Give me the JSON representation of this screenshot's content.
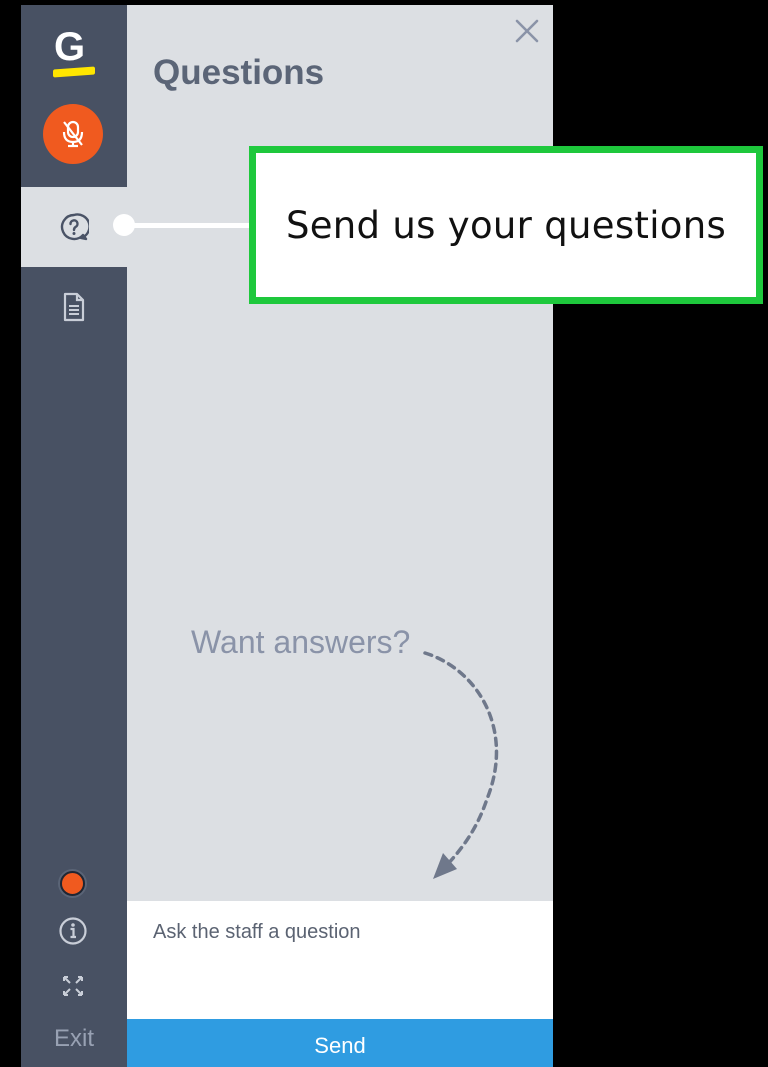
{
  "sidebar": {
    "logo_letter": "G",
    "icons": {
      "mic": "mic-off-icon",
      "questions": "question-bubble-icon",
      "handouts": "document-icon",
      "info": "info-icon",
      "fullscreen": "fullscreen-icon"
    },
    "exit_label": "Exit"
  },
  "panel": {
    "title": "Questions",
    "hint": "Want answers?",
    "input_placeholder": "Ask the staff a question",
    "send_label": "Send"
  },
  "tooltip": {
    "text": "Send us your questions"
  },
  "colors": {
    "sidebar_bg": "#485163",
    "panel_bg": "#dcdfe3",
    "accent_orange": "#f05a1f",
    "send_blue": "#2f9ce1",
    "logo_yellow": "#ffe600",
    "callout_green": "#1ec83c"
  }
}
